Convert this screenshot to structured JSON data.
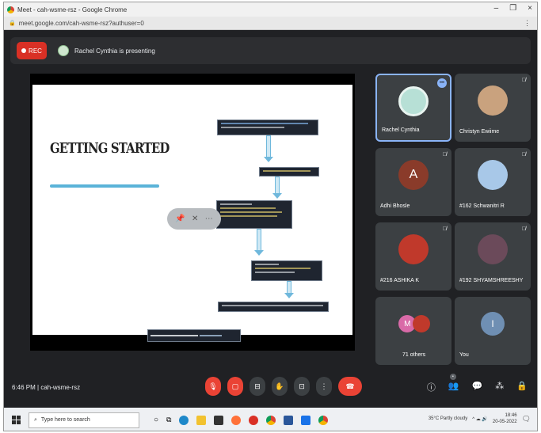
{
  "browser": {
    "title": "Meet - cah-wsme-rsz - Google Chrome",
    "minimize": "–",
    "maximize": "❐",
    "close": "×",
    "url": "meet.google.com/cah-wsme-rsz?authuser=0",
    "menu_icon": "⋮"
  },
  "meet_header": {
    "rec_label": "REC",
    "presenting_text": "Rachel Cynthia is presenting"
  },
  "slide": {
    "title": "GETTING STARTED"
  },
  "participants": [
    {
      "name": "Rachel Cynthia",
      "avatar_color": "#b7e0d6",
      "initial": "",
      "active": true
    },
    {
      "name": "Christyn Ewiime",
      "avatar_color": "#c9a27e",
      "initial": "",
      "active": false
    },
    {
      "name": "Adhi Bhosle",
      "avatar_color": "#8a3b2a",
      "initial": "A",
      "active": false
    },
    {
      "name": "#162 Schwanitri R",
      "avatar_color": "#a8c8e8",
      "initial": "",
      "active": false
    },
    {
      "name": "#216 ASHIKA K",
      "avatar_color": "#c0392b",
      "initial": "",
      "active": false
    },
    {
      "name": "#192 SHYAMSHREESHY",
      "avatar_color": "#6b4a5a",
      "initial": "",
      "active": false
    },
    {
      "name": "71 others",
      "avatar_color": "#d96aa8",
      "initial": "M",
      "active": false
    },
    {
      "name": "You",
      "avatar_color": "#6f8fb3",
      "initial": "I",
      "active": false
    }
  ],
  "bottom_bar": {
    "time_meeting": "6:46 PM  |  cah-wsme-rsz"
  },
  "taskbar": {
    "search_placeholder": "Type here to search",
    "weather": "35°C  Partly cloudy",
    "time": "18:46",
    "date": "20-05-2022"
  },
  "colors": {
    "meet_bg": "#202124",
    "end_call": "#ea4335",
    "accent": "#8ab4f8"
  }
}
